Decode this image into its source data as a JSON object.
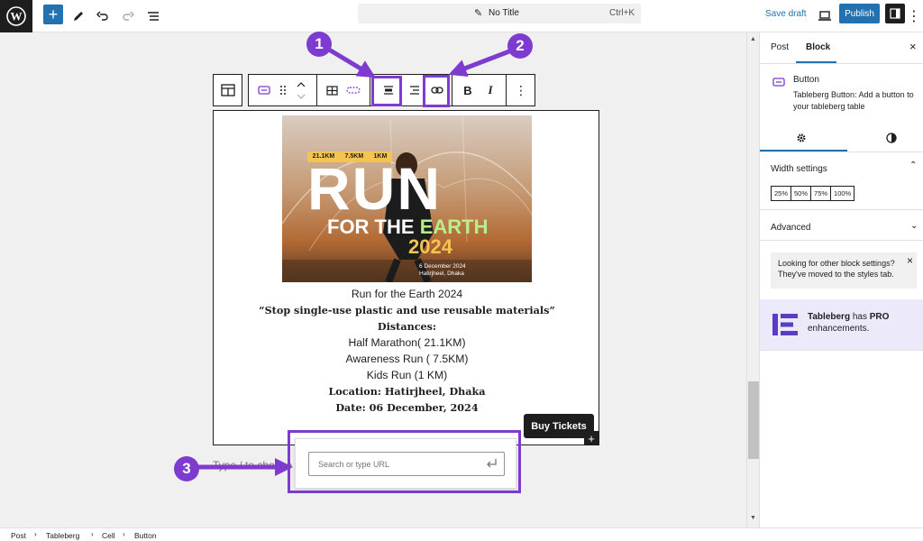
{
  "topbar": {
    "doc_title": "No Title",
    "shortcut": "Ctrl+K",
    "save_draft": "Save draft",
    "publish": "Publish"
  },
  "poster": {
    "distance_tags": [
      "21.1KM",
      "7.5KM",
      "1KM"
    ],
    "run_text": "RUN",
    "earth_prefix": "FOR THE",
    "earth_word": "EARTH",
    "year": "2024",
    "date_line": "6 December 2024",
    "place_line": "Hatirjheel, Dhaka"
  },
  "content": {
    "event_title": "Run for the Earth 2024",
    "slogan": "“Stop single-use plastic and use reusable materials”",
    "distances_label": "Distances:",
    "half": "Half Marathon( 21.1KM)",
    "awareness": "Awareness Run ( 7.5KM)",
    "kids": "Kids Run (1 KM)",
    "location": "Location: Hatirjheel, Dhaka",
    "date": "Date: 06 December, 2024"
  },
  "button_label": "Buy Tickets",
  "link_popover": {
    "placeholder": "Search or type URL"
  },
  "type_hint": "Type / to choose",
  "annotations": [
    "1",
    "2",
    "3"
  ],
  "sidebar": {
    "tabs": [
      "Post",
      "Block"
    ],
    "active_tab": "Block",
    "block_name": "Button",
    "block_desc": "Tableberg Button: Add a button to your tableberg table",
    "width_settings_title": "Width settings",
    "width_options": [
      "25%",
      "50%",
      "75%",
      "100%"
    ],
    "advanced_title": "Advanced",
    "notice": "Looking for other block settings? They've moved to the styles tab.",
    "pro_brand": "Tableberg",
    "pro_has": " has ",
    "pro_word": "PRO",
    "pro_rest": "enhancements."
  },
  "breadcrumb": [
    "Post",
    "Tableberg",
    "Cell",
    "Button"
  ],
  "colors": {
    "accent": "#7e3bd0",
    "wp_blue": "#2271b1",
    "dark": "#1e1e1e"
  }
}
